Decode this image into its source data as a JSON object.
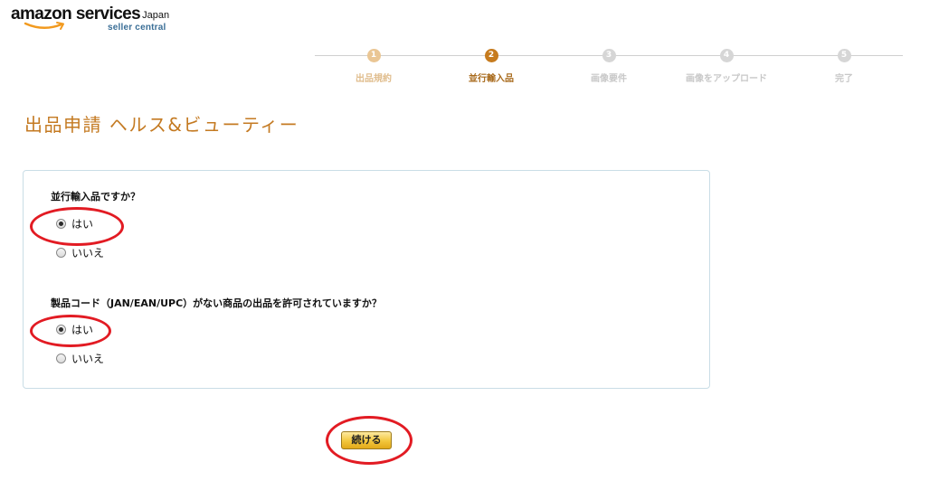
{
  "logo": {
    "brand": "amazon services",
    "country": "Japan",
    "sub": "seller central"
  },
  "steps": [
    {
      "number": "1",
      "label": "出品規約",
      "state": "done"
    },
    {
      "number": "2",
      "label": "並行輸入品",
      "state": "current"
    },
    {
      "number": "3",
      "label": "画像要件",
      "state": "upcoming"
    },
    {
      "number": "4",
      "label": "画像をアップロード",
      "state": "upcoming"
    },
    {
      "number": "5",
      "label": "完了",
      "state": "upcoming"
    }
  ],
  "page": {
    "title": "出品申請 ヘルス&ビューティー"
  },
  "form": {
    "question1": {
      "text": "並行輸入品ですか？",
      "yes_label": "はい",
      "no_label": "いいえ",
      "selected": "はい"
    },
    "question2": {
      "text": "製品コード（JAN/EAN/UPC）がない商品の出品を許可されていますか？",
      "yes_label": "はい",
      "no_label": "いいえ",
      "selected": "はい"
    },
    "continue_label": "続ける"
  },
  "colors": {
    "accent": "#c47a22",
    "step_current": "#c67b1e",
    "step_done": "#eac694",
    "highlight": "#e21b23",
    "button": "#f2c63c",
    "panel_border": "#c9dde6"
  }
}
